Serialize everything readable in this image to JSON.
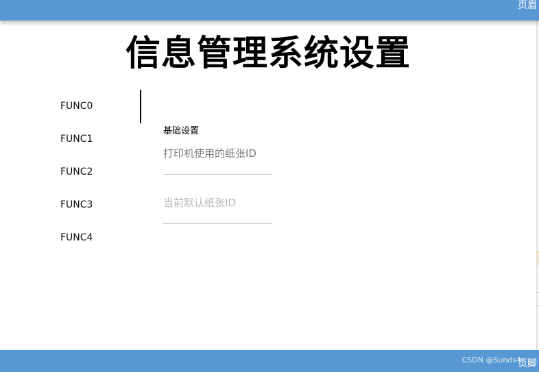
{
  "header": {
    "label": "页眉"
  },
  "title": "信息管理系统设置",
  "nav": {
    "items": [
      {
        "label": "FUNC0",
        "selected": true
      },
      {
        "label": "FUNC1",
        "selected": false
      },
      {
        "label": "FUNC2",
        "selected": false
      },
      {
        "label": "FUNC3",
        "selected": false
      },
      {
        "label": "FUNC4",
        "selected": false
      }
    ]
  },
  "panel": {
    "section_title": "基础设置",
    "fields": [
      {
        "label": "打印机使用的纸张ID",
        "value": ""
      },
      {
        "label": "当前默认纸张ID",
        "value": ""
      }
    ]
  },
  "footer": {
    "label": "页脚",
    "watermark": "CSDN @Sunds4"
  },
  "colors": {
    "bar": "#5797d4",
    "indicator": "#000000",
    "field_underline": "#c4c4c4"
  }
}
